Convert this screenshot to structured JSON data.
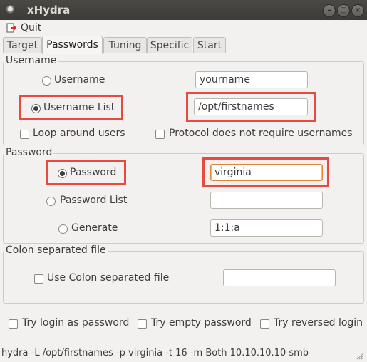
{
  "window": {
    "title": "xHydra",
    "controls": [
      "minimize",
      "maximize",
      "close"
    ]
  },
  "menu": {
    "quit": "Quit",
    "quit_icon": "quit-icon"
  },
  "tabs": [
    {
      "label": "Target",
      "active": false
    },
    {
      "label": "Passwords",
      "active": true
    },
    {
      "label": "Tuning",
      "active": false
    },
    {
      "label": "Specific",
      "active": false
    },
    {
      "label": "Start",
      "active": false
    }
  ],
  "username_section": {
    "title": "Username",
    "username_radio": "Username",
    "username_value": "yourname",
    "username_list_radio": "Username List",
    "username_list_selected": true,
    "username_list_value": "/opt/firstnames",
    "loop_around_users": "Loop around users",
    "protocol_no_usernames": "Protocol does not require usernames"
  },
  "password_section": {
    "title": "Password",
    "password_radio": "Password",
    "password_selected": true,
    "password_value": "virginia",
    "password_list_radio": "Password List",
    "password_list_value": "",
    "generate_radio": "Generate",
    "generate_value": "1:1:a"
  },
  "colon_section": {
    "title": "Colon separated file",
    "use_colon_file": "Use Colon separated file",
    "colon_file_value": ""
  },
  "options": {
    "try_login_as_password": "Try login as password",
    "try_empty_password": "Try empty password",
    "try_reversed_login": "Try reversed login"
  },
  "status": {
    "command": "hydra -L /opt/firstnames -p virginia -t 16 -m Both 10.10.10.10 smb"
  },
  "colors": {
    "highlight": "#e84a3f",
    "titlebar": "#3c3b37",
    "background": "#f2f1f0"
  }
}
